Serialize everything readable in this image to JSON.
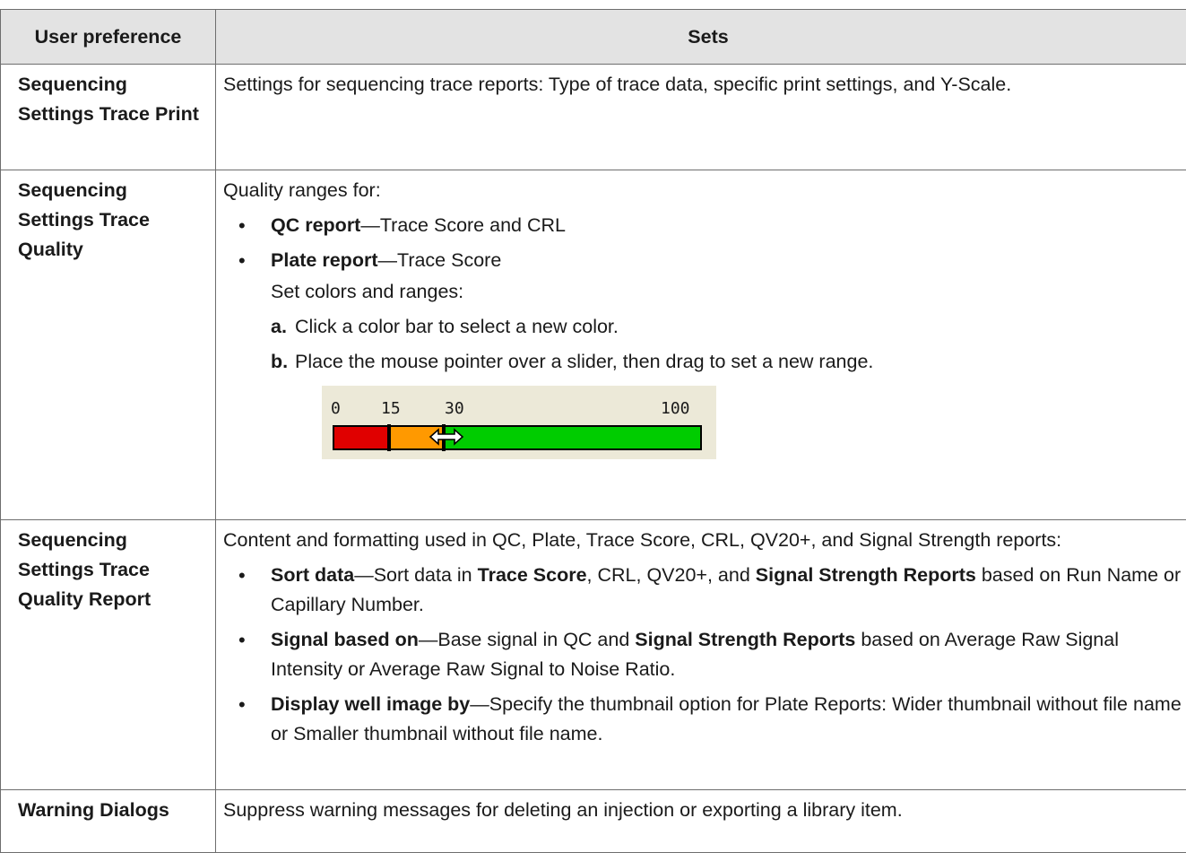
{
  "header": {
    "col1": "User preference",
    "col2": "Sets"
  },
  "rows": [
    {
      "name": "Sequencing Settings Trace Print",
      "text": "Settings for sequencing trace reports: Type of trace data, specific print settings, and Y-Scale."
    },
    {
      "name": "Sequencing Settings Trace Quality",
      "intro": "Quality ranges for:",
      "bullets": [
        {
          "term": "QC report",
          "desc": "—Trace Score and CRL"
        },
        {
          "term": "Plate report",
          "desc": "—Trace Score"
        }
      ],
      "set_colors": "Set colors and ranges:",
      "steps": [
        {
          "letter": "a.",
          "text": "Click a color bar to select a new color."
        },
        {
          "letter": "b.",
          "text": "Place the mouse pointer over a slider, then drag to set a new range."
        }
      ],
      "slider": {
        "ticks": [
          "0",
          "15",
          "30",
          "100"
        ],
        "thresholds": [
          0,
          15,
          30,
          100
        ],
        "colors": {
          "low": "#e00000",
          "mid": "#ff9900",
          "high": "#00cc00"
        },
        "cursor_icon": "horizontal-resize-cursor"
      }
    },
    {
      "name": "Sequencing Settings Trace Quality Report",
      "intro": "Content and formatting used in QC, Plate, Trace Score, CRL, QV20+, and Signal Strength reports:",
      "b1": {
        "term": "Sort data",
        "t1": "—Sort data in ",
        "bold1": "Trace Score",
        "t2": ", CRL, QV20+, and ",
        "bold2": "Signal Strength Reports",
        "t3": " based on Run Name or Capillary Number."
      },
      "b2": {
        "term": "Signal based on",
        "t1": "—Base signal in QC and ",
        "bold1": "Signal Strength Reports",
        "t2": " based on Average Raw Signal Intensity or Average Raw Signal to Noise Ratio."
      },
      "b3": {
        "term": "Display well image by",
        "t1": "—Specify the thumbnail option for Plate Reports: Wider thumbnail without file name or Smaller thumbnail without file name."
      }
    },
    {
      "name": "Warning Dialogs",
      "text": "Suppress warning messages for deleting an injection or exporting a library item."
    }
  ]
}
